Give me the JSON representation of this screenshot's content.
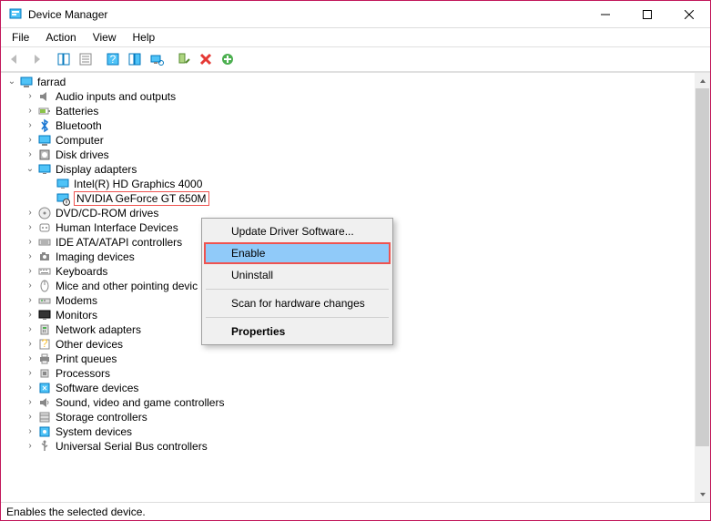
{
  "window": {
    "title": "Device Manager"
  },
  "menubar": [
    "File",
    "Action",
    "View",
    "Help"
  ],
  "tree": {
    "root": "farrad",
    "nodes": [
      {
        "label": "Audio inputs and outputs",
        "expanded": false,
        "icon": "audio"
      },
      {
        "label": "Batteries",
        "expanded": false,
        "icon": "battery"
      },
      {
        "label": "Bluetooth",
        "expanded": false,
        "icon": "bluetooth"
      },
      {
        "label": "Computer",
        "expanded": false,
        "icon": "computer"
      },
      {
        "label": "Disk drives",
        "expanded": false,
        "icon": "disk"
      },
      {
        "label": "Display adapters",
        "expanded": true,
        "icon": "display",
        "children": [
          {
            "label": "Intel(R) HD Graphics 4000",
            "icon": "display"
          },
          {
            "label": "NVIDIA GeForce GT 650M",
            "icon": "display-warn",
            "selected": true
          }
        ]
      },
      {
        "label": "DVD/CD-ROM drives",
        "expanded": false,
        "icon": "dvd"
      },
      {
        "label": "Human Interface Devices",
        "expanded": false,
        "icon": "hid"
      },
      {
        "label": "IDE ATA/ATAPI controllers",
        "expanded": false,
        "icon": "ide"
      },
      {
        "label": "Imaging devices",
        "expanded": false,
        "icon": "imaging"
      },
      {
        "label": "Keyboards",
        "expanded": false,
        "icon": "keyboard"
      },
      {
        "label": "Mice and other pointing devices",
        "expanded": false,
        "icon": "mouse",
        "truncated": "Mice and other pointing devic"
      },
      {
        "label": "Modems",
        "expanded": false,
        "icon": "modem"
      },
      {
        "label": "Monitors",
        "expanded": false,
        "icon": "monitor"
      },
      {
        "label": "Network adapters",
        "expanded": false,
        "icon": "network"
      },
      {
        "label": "Other devices",
        "expanded": false,
        "icon": "other"
      },
      {
        "label": "Print queues",
        "expanded": false,
        "icon": "print"
      },
      {
        "label": "Processors",
        "expanded": false,
        "icon": "cpu"
      },
      {
        "label": "Software devices",
        "expanded": false,
        "icon": "software"
      },
      {
        "label": "Sound, video and game controllers",
        "expanded": false,
        "icon": "sound"
      },
      {
        "label": "Storage controllers",
        "expanded": false,
        "icon": "storage"
      },
      {
        "label": "System devices",
        "expanded": false,
        "icon": "system"
      },
      {
        "label": "Universal Serial Bus controllers",
        "expanded": false,
        "icon": "usb",
        "truncated": "Universal Serial Bus controllers"
      }
    ]
  },
  "contextmenu": {
    "items": [
      {
        "label": "Update Driver Software...",
        "type": "item"
      },
      {
        "label": "Enable",
        "type": "item",
        "highlighted": true
      },
      {
        "label": "Uninstall",
        "type": "item"
      },
      {
        "type": "sep"
      },
      {
        "label": "Scan for hardware changes",
        "type": "item"
      },
      {
        "type": "sep"
      },
      {
        "label": "Properties",
        "type": "item",
        "bold": true
      }
    ]
  },
  "statusbar": "Enables the selected device."
}
